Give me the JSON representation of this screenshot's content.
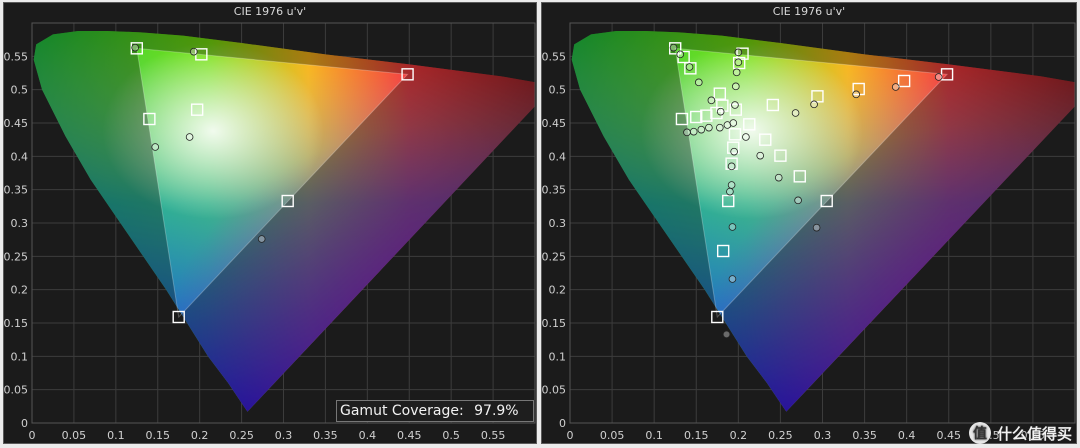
{
  "left_panel": {
    "title": "CIE 1976 u'v'",
    "coverage_label": "Gamut Coverage:",
    "coverage_value": "97.9%"
  },
  "right_panel": {
    "title": "CIE 1976 u'v'"
  },
  "watermark": {
    "icon": "值",
    "text": "什么值得买"
  },
  "chart_data": [
    {
      "type": "scatter",
      "title": "CIE 1976 u'v'",
      "xlim": [
        0,
        0.6
      ],
      "ylim": [
        0,
        0.6
      ],
      "x_ticks": [
        "0",
        "0.05",
        "0.1",
        "0.15",
        "0.2",
        "0.25",
        "0.3",
        "0.35",
        "0.4",
        "0.45",
        "0.5",
        "0.55"
      ],
      "y_ticks": [
        "0",
        "0.05",
        "0.1",
        "0.15",
        "0.2",
        "0.25",
        "0.3",
        "0.35",
        "0.4",
        "0.45",
        "0.5",
        "0.55"
      ],
      "series": [
        {
          "marker": "square",
          "points": [
            [
              0.125,
              0.562
            ],
            [
              0.202,
              0.553
            ],
            [
              0.448,
              0.523
            ],
            [
              0.14,
              0.456
            ],
            [
              0.197,
              0.47
            ],
            [
              0.305,
              0.333
            ],
            [
              0.175,
              0.159
            ]
          ]
        },
        {
          "marker": "circle",
          "points": [
            [
              0.123,
              0.563
            ],
            [
              0.193,
              0.557
            ],
            [
              0.147,
              0.414
            ],
            [
              0.188,
              0.429
            ],
            [
              0.274,
              0.276
            ]
          ]
        }
      ],
      "annotation": "Gamut Coverage: 97.9%"
    },
    {
      "type": "scatter",
      "title": "CIE 1976 u'v'",
      "xlim": [
        0,
        0.6
      ],
      "ylim": [
        0,
        0.6
      ],
      "x_ticks": [
        "0",
        "0.05",
        "0.1",
        "0.15",
        "0.2",
        "0.25",
        "0.3",
        "0.35",
        "0.4",
        "0.45",
        "0.5",
        "0.55"
      ],
      "y_ticks": [
        "0",
        "0.05",
        "0.1",
        "0.15",
        "0.2",
        "0.25",
        "0.3",
        "0.35",
        "0.4",
        "0.45",
        "0.5",
        "0.55"
      ],
      "series": [
        {
          "marker": "square",
          "points": [
            [
              0.125,
              0.562
            ],
            [
              0.135,
              0.549
            ],
            [
              0.143,
              0.532
            ],
            [
              0.205,
              0.554
            ],
            [
              0.448,
              0.523
            ],
            [
              0.397,
              0.513
            ],
            [
              0.343,
              0.501
            ],
            [
              0.294,
              0.49
            ],
            [
              0.241,
              0.477
            ],
            [
              0.133,
              0.456
            ],
            [
              0.15,
              0.459
            ],
            [
              0.162,
              0.461
            ],
            [
              0.174,
              0.465
            ],
            [
              0.197,
              0.47
            ],
            [
              0.213,
              0.448
            ],
            [
              0.196,
              0.433
            ],
            [
              0.232,
              0.425
            ],
            [
              0.194,
              0.413
            ],
            [
              0.25,
              0.401
            ],
            [
              0.192,
              0.389
            ],
            [
              0.273,
              0.37
            ],
            [
              0.188,
              0.333
            ],
            [
              0.305,
              0.333
            ],
            [
              0.182,
              0.258
            ],
            [
              0.175,
              0.159
            ],
            [
              0.178,
              0.494
            ],
            [
              0.201,
              0.54
            ],
            [
              0.181,
              0.476
            ]
          ]
        },
        {
          "marker": "circle",
          "points": [
            [
              0.123,
              0.563
            ],
            [
              0.131,
              0.553
            ],
            [
              0.142,
              0.534
            ],
            [
              0.153,
              0.511
            ],
            [
              0.168,
              0.484
            ],
            [
              0.179,
              0.467
            ],
            [
              0.196,
              0.477
            ],
            [
              0.2,
              0.556
            ],
            [
              0.2,
              0.541
            ],
            [
              0.198,
              0.526
            ],
            [
              0.197,
              0.505
            ],
            [
              0.139,
              0.436
            ],
            [
              0.147,
              0.437
            ],
            [
              0.156,
              0.44
            ],
            [
              0.165,
              0.443
            ],
            [
              0.178,
              0.443
            ],
            [
              0.187,
              0.447
            ],
            [
              0.194,
              0.45
            ],
            [
              0.209,
              0.429
            ],
            [
              0.195,
              0.407
            ],
            [
              0.226,
              0.401
            ],
            [
              0.192,
              0.385
            ],
            [
              0.248,
              0.368
            ],
            [
              0.192,
              0.357
            ],
            [
              0.19,
              0.347
            ],
            [
              0.271,
              0.334
            ],
            [
              0.293,
              0.293
            ],
            [
              0.193,
              0.294
            ],
            [
              0.193,
              0.216
            ],
            [
              0.186,
              0.133
            ],
            [
              0.29,
              0.478
            ],
            [
              0.34,
              0.493
            ],
            [
              0.387,
              0.504
            ],
            [
              0.438,
              0.519
            ],
            [
              0.268,
              0.465
            ]
          ]
        }
      ]
    }
  ]
}
